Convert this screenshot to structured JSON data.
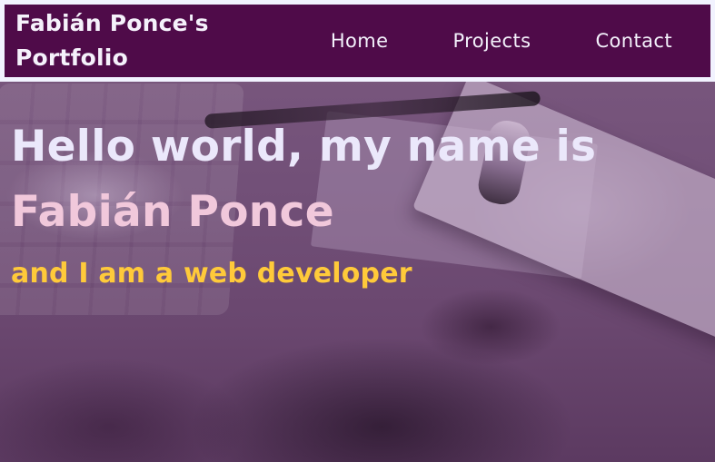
{
  "navbar": {
    "brand": "Fabián Ponce's\nPortfolio",
    "links": [
      {
        "label": "Home"
      },
      {
        "label": "Projects"
      },
      {
        "label": "Contact"
      }
    ]
  },
  "hero": {
    "headline": "Hello world, my name is",
    "name": "Fabián Ponce",
    "subtitle": "and I am a web developer"
  },
  "colors": {
    "nav_background": "#4f0b49",
    "headline_text": "#ebe8fb",
    "name_text": "#f1c8db",
    "subtitle_text": "#ffca3a"
  }
}
